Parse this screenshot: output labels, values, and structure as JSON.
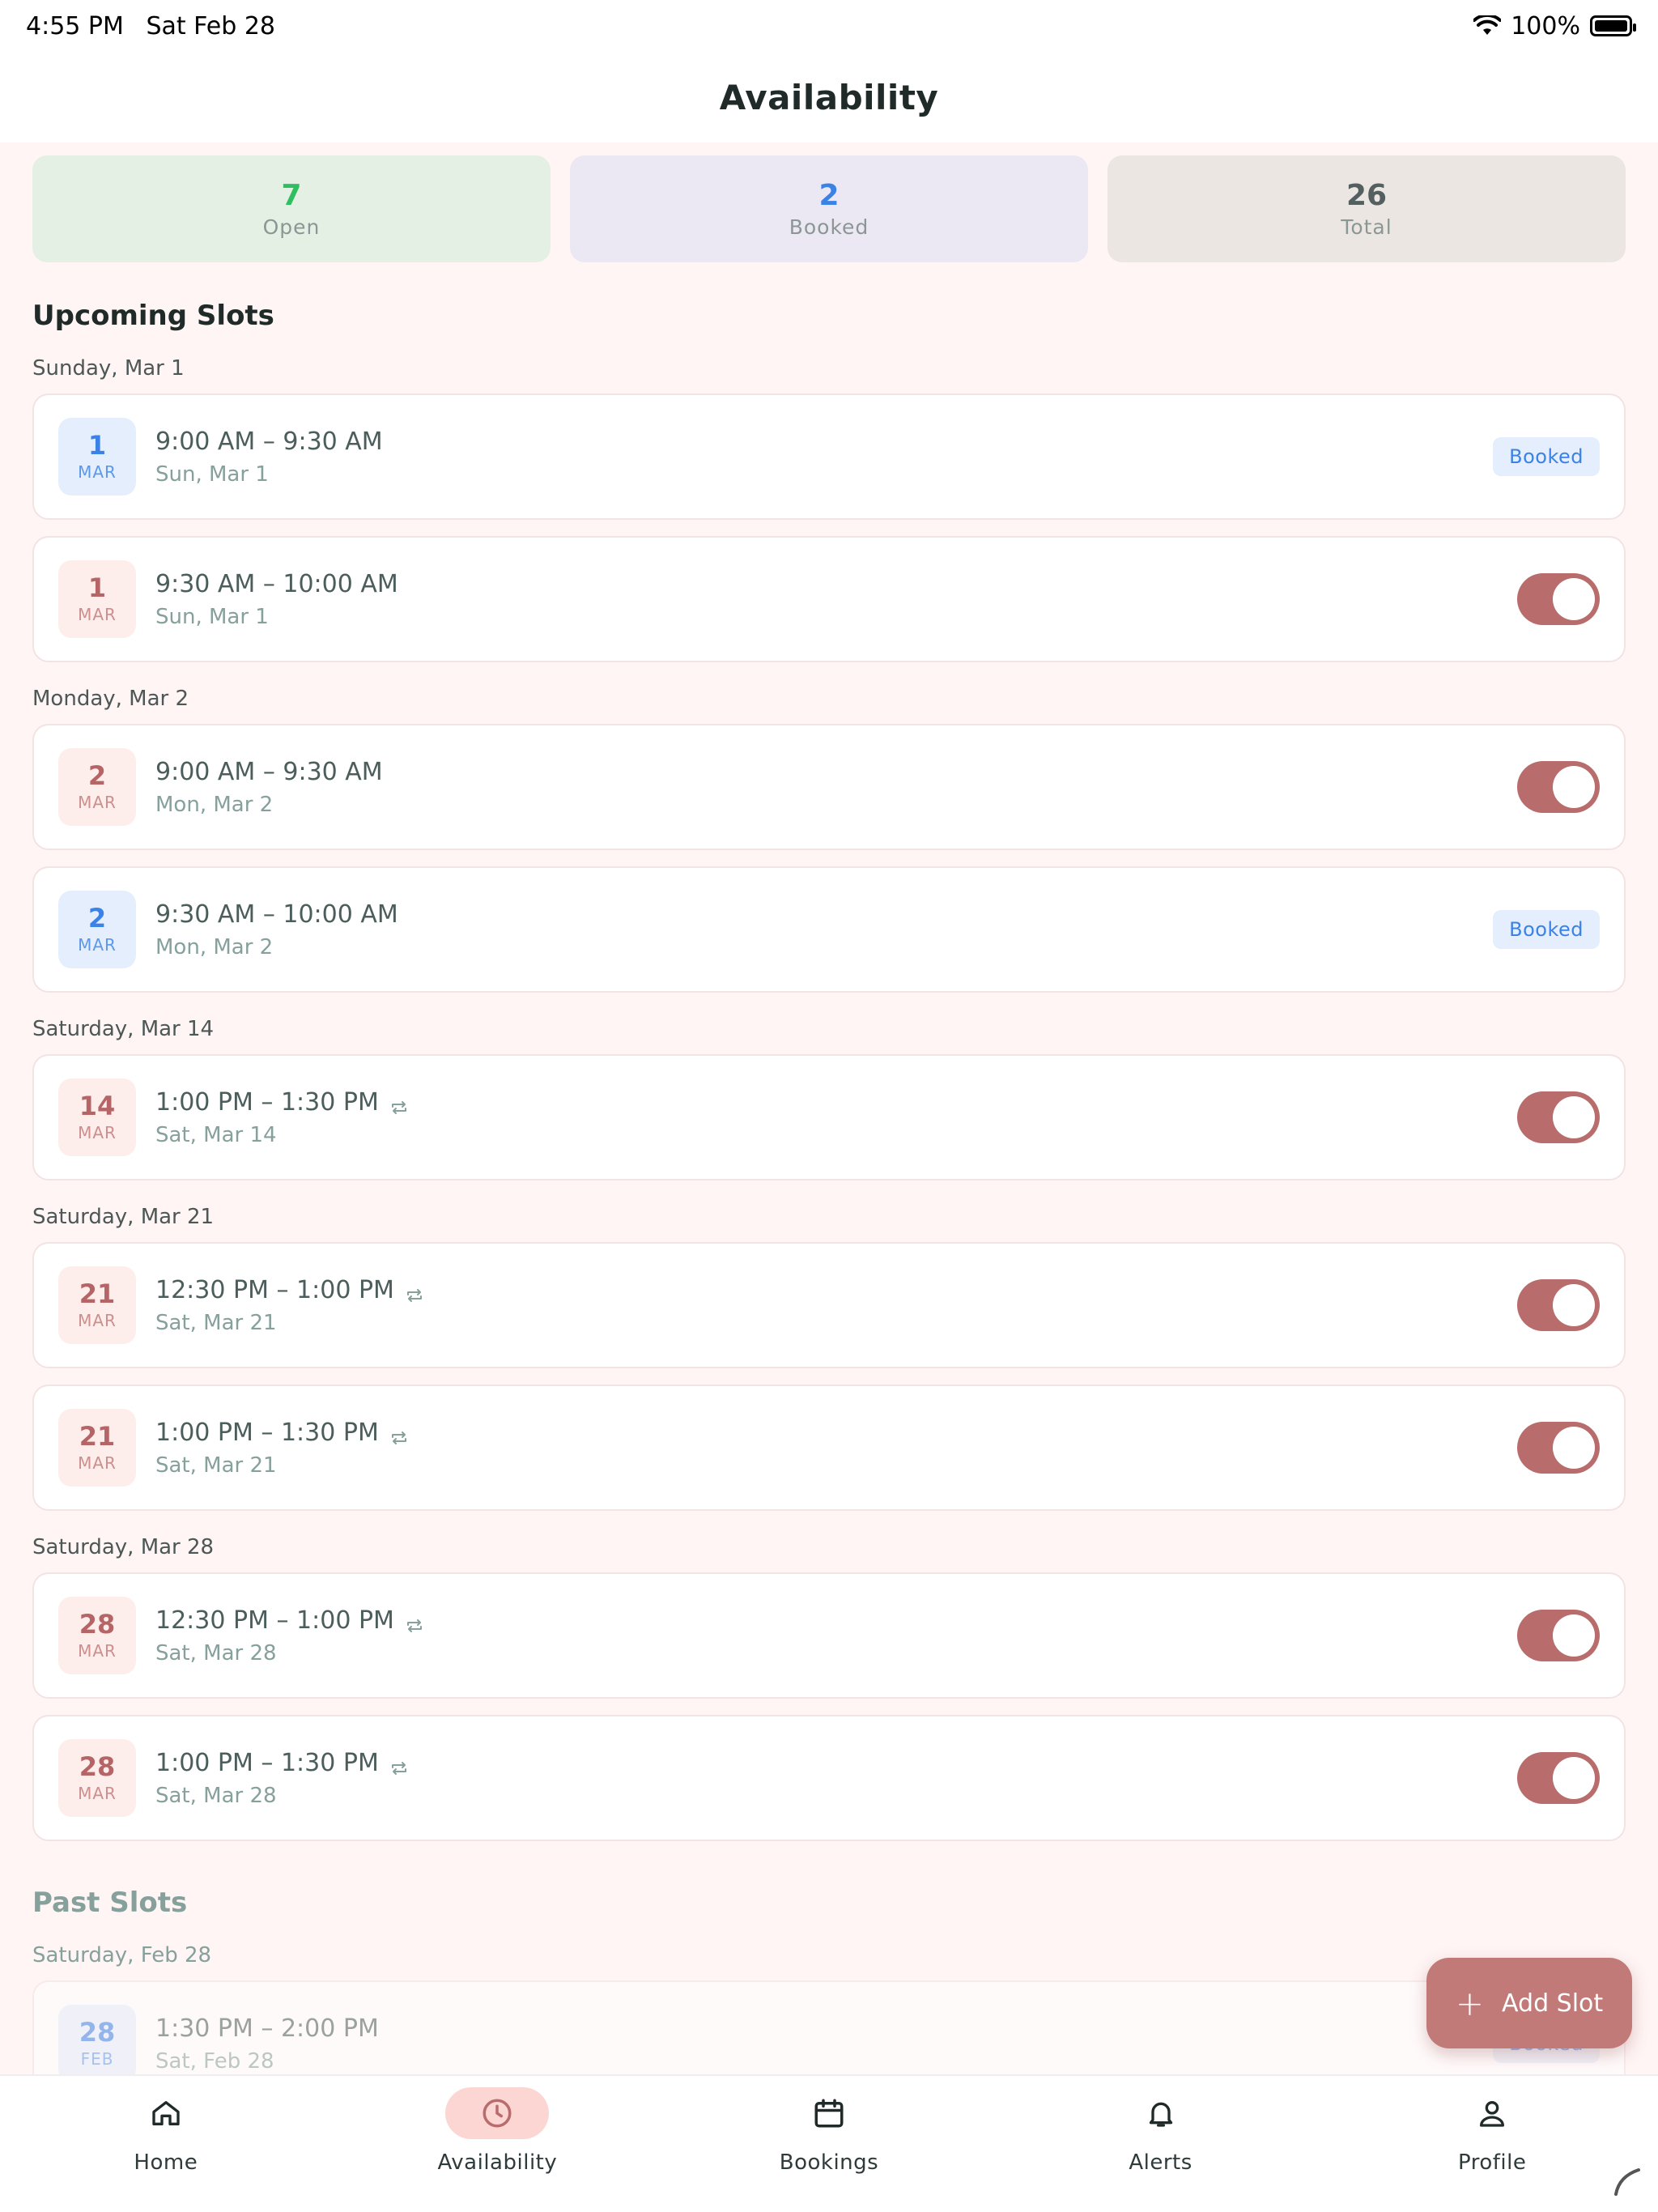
{
  "status": {
    "time": "4:55 PM",
    "date": "Sat Feb 28",
    "battery": "100%"
  },
  "header": {
    "title": "Availability"
  },
  "stats": [
    {
      "value": "7",
      "label": "Open"
    },
    {
      "value": "2",
      "label": "Booked"
    },
    {
      "value": "26",
      "label": "Total"
    }
  ],
  "upcoming": {
    "title": "Upcoming Slots",
    "groups": [
      {
        "day": "Sunday, Mar 1",
        "slots": [
          {
            "d": "1",
            "m": "MAR",
            "time": "9:00 AM – 9:30 AM",
            "sub": "Sun, Mar 1",
            "status": "Booked"
          },
          {
            "d": "1",
            "m": "MAR",
            "time": "9:30 AM – 10:00 AM",
            "sub": "Sun, Mar 1"
          }
        ]
      },
      {
        "day": "Monday, Mar 2",
        "slots": [
          {
            "d": "2",
            "m": "MAR",
            "time": "9:00 AM – 9:30 AM",
            "sub": "Mon, Mar 2"
          },
          {
            "d": "2",
            "m": "MAR",
            "time": "9:30 AM – 10:00 AM",
            "sub": "Mon, Mar 2",
            "status": "Booked"
          }
        ]
      },
      {
        "day": "Saturday, Mar 14",
        "slots": [
          {
            "d": "14",
            "m": "MAR",
            "time": "1:00 PM – 1:30 PM",
            "sub": "Sat, Mar 14"
          }
        ]
      },
      {
        "day": "Saturday, Mar 21",
        "slots": [
          {
            "d": "21",
            "m": "MAR",
            "time": "12:30 PM – 1:00 PM",
            "sub": "Sat, Mar 21"
          },
          {
            "d": "21",
            "m": "MAR",
            "time": "1:00 PM – 1:30 PM",
            "sub": "Sat, Mar 21"
          }
        ]
      },
      {
        "day": "Saturday, Mar 28",
        "slots": [
          {
            "d": "28",
            "m": "MAR",
            "time": "12:30 PM – 1:00 PM",
            "sub": "Sat, Mar 28"
          },
          {
            "d": "28",
            "m": "MAR",
            "time": "1:00 PM – 1:30 PM",
            "sub": "Sat, Mar 28"
          }
        ]
      }
    ]
  },
  "past": {
    "title": "Past Slots",
    "groups": [
      {
        "day": "Saturday, Feb 28",
        "slots": [
          {
            "d": "28",
            "m": "FEB",
            "time": "1:30 PM – 2:00 PM",
            "sub": "Sat, Feb 28",
            "status": "Booked"
          }
        ]
      }
    ]
  },
  "fab": {
    "label": "Add Slot"
  },
  "tabs": [
    {
      "label": "Home",
      "icon": "home-icon"
    },
    {
      "label": "Availability",
      "icon": "clock-icon",
      "active": true
    },
    {
      "label": "Bookings",
      "icon": "calendar-icon"
    },
    {
      "label": "Alerts",
      "icon": "bell-icon"
    },
    {
      "label": "Profile",
      "icon": "person-icon"
    }
  ]
}
